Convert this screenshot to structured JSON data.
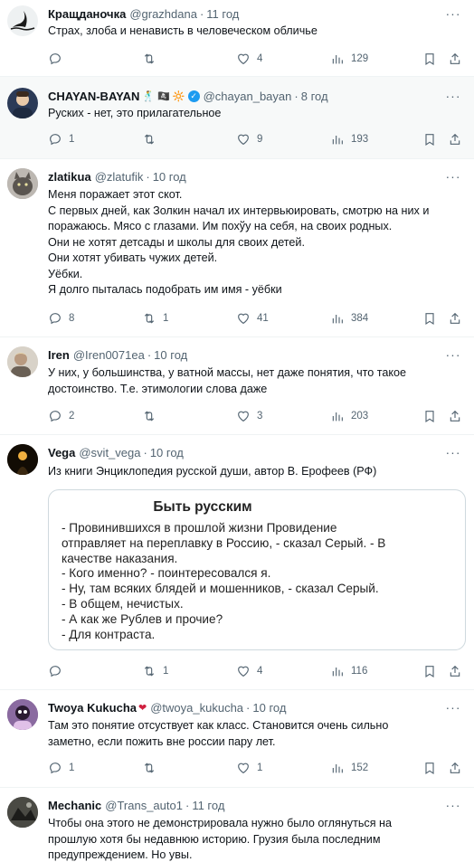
{
  "tweets": [
    {
      "name": "Кращданочка",
      "handle": "@grazhdana",
      "time": "11 год",
      "lines": [
        "Страх, злоба и ненависть в человеческом обличье"
      ],
      "stats": {
        "reply": "",
        "retweet": "",
        "like": "4",
        "views": "129"
      },
      "avatar_color": "#f2f2f2"
    },
    {
      "name": "CHAYAN-BAYAN",
      "emoji_badges": "🕺 🏴‍☠️ 🔆",
      "handle": "@chayan_bayan",
      "time": "8 год",
      "lines": [
        "Руских - нет, это прилагательное"
      ],
      "stats": {
        "reply": "1",
        "retweet": "",
        "like": "9",
        "views": "193"
      },
      "avatar_color": "#2b3a57"
    },
    {
      "name": "zlatikua",
      "handle": "@zlatufik",
      "time": "10 год",
      "lines": [
        "Меня поражает этот скот.",
        "С первых дней, как Золкин начал их интервьюировать, смотрю на них и",
        "поражаюсь. Мясо с глазами. Им похўу на себя, на своих родных.",
        "Они не хотят детсады и школы для своих детей.",
        "Они хотят убивать чужих детей.",
        "Уёбки.",
        "Я долго пыталась подобрать им имя - уёбки"
      ],
      "stats": {
        "reply": "8",
        "retweet": "1",
        "like": "41",
        "views": "384"
      },
      "avatar_color": "#8a8a8a"
    },
    {
      "name": "Iren",
      "handle": "@Iren0071ea",
      "time": "10 год",
      "lines": [
        "У них, у большинства, у ватной массы, нет даже понятия, что такое",
        "достоинство. Т.е. этимологии слова даже"
      ],
      "stats": {
        "reply": "2",
        "retweet": "",
        "like": "3",
        "views": "203"
      },
      "avatar_color": "#c9c2b8"
    },
    {
      "name": "Vega",
      "handle": "@svit_vega",
      "time": "10 год",
      "lines": [
        "Из книги Энциклопедия русской души, автор В. Ерофеев (РФ)"
      ],
      "card": {
        "title": "Быть русским",
        "lines": [
          "- Провинившихся в прошлой жизни Провидение",
          "отправляет на переплавку в Россию, - сказал Серый. - В",
          "качестве наказания.",
          "- Кого именно? - поинтересовался я.",
          "- Ну, там всяких блядей и мошенников, - сказал Серый.",
          "- В общем, нечистых.",
          "- А как же Рублев и прочие?",
          "- Для контраста."
        ]
      },
      "stats": {
        "reply": "",
        "retweet": "1",
        "like": "4",
        "views": "116"
      },
      "avatar_color": "#1a1208"
    },
    {
      "name": "Twoya Kukucha",
      "handle": "@twoya_kukucha",
      "time": "10 год",
      "lines": [
        "Там это понятие отсуствует как класс. Становится очень сильно",
        "заметно, если пожить вне россии пару лет."
      ],
      "stats": {
        "reply": "1",
        "retweet": "",
        "like": "1",
        "views": "152"
      },
      "avatar_color": "#6b4a7a"
    },
    {
      "name": "Mechanic",
      "handle": "@Trans_auto1",
      "time": "11 год",
      "lines": [
        "Чтобы она этого не демонстрировала нужно было оглянуться на",
        "прошлую хотя бы недавнюю историю. Грузия была последним",
        "предупреждением. Но увы."
      ],
      "stats": {
        "reply": "",
        "retweet": "",
        "like": "",
        "views": ""
      },
      "avatar_color": "#3a3a3a"
    }
  ],
  "icons": {
    "reply": "reply-icon",
    "retweet": "retweet-icon",
    "like": "like-icon",
    "views": "views-icon",
    "bookmark": "bookmark-icon",
    "share": "share-icon",
    "more": "more-icon"
  }
}
